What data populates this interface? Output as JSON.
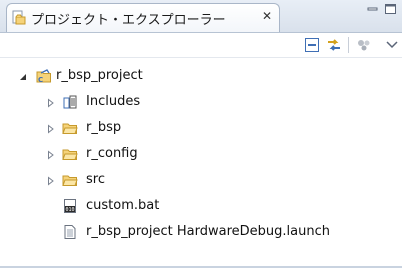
{
  "tab": {
    "title": "プロジェクト・エクスプローラー",
    "close_symbol": "✕",
    "icon": "project-explorer-icon"
  },
  "window_controls": {
    "minimize_icon": "minimize-icon",
    "maximize_icon": "maximize-icon"
  },
  "toolbar": {
    "buttons": [
      {
        "icon": "collapse-all-icon"
      },
      {
        "icon": "link-with-editor-icon"
      },
      {
        "icon": "view-menu-filter-icon"
      },
      {
        "icon": "view-menu-chevron-icon"
      }
    ]
  },
  "tree": {
    "project": {
      "label": "r_bsp_project",
      "expanded": true,
      "icon": "c-project-folder-icon"
    },
    "children": [
      {
        "label": "Includes",
        "icon": "includes-icon",
        "expandable": true
      },
      {
        "label": "r_bsp",
        "icon": "source-folder-icon",
        "expandable": true
      },
      {
        "label": "r_config",
        "icon": "source-folder-icon",
        "expandable": true
      },
      {
        "label": "src",
        "icon": "source-folder-icon",
        "expandable": true
      },
      {
        "label": "custom.bat",
        "icon": "batch-file-icon",
        "expandable": false
      },
      {
        "label": "r_bsp_project HardwareDebug.launch",
        "icon": "launch-file-icon",
        "expandable": false
      }
    ]
  },
  "colors": {
    "folder_fill": "#f5d37a",
    "folder_stroke": "#c69a2c",
    "accent_blue": "#3f6fb5"
  }
}
